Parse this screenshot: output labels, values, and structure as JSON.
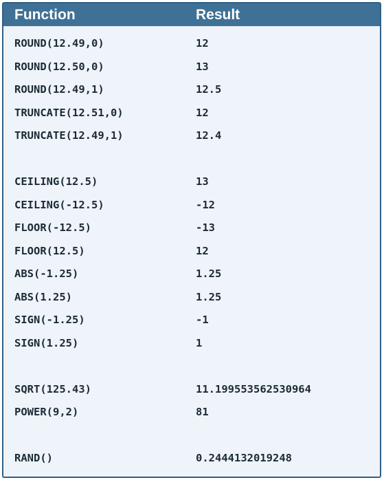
{
  "header": {
    "function_label": "Function",
    "result_label": "Result"
  },
  "rows": [
    {
      "fn": "ROUND(12.49,0)",
      "res": "12"
    },
    {
      "fn": "ROUND(12.50,0)",
      "res": "13"
    },
    {
      "fn": "ROUND(12.49,1)",
      "res": "12.5"
    },
    {
      "fn": "TRUNCATE(12.51,0)",
      "res": "12"
    },
    {
      "fn": "TRUNCATE(12.49,1)",
      "res": "12.4"
    },
    {
      "fn": "CEILING(12.5)",
      "res": "13"
    },
    {
      "fn": "CEILING(-12.5)",
      "res": "-12"
    },
    {
      "fn": "FLOOR(-12.5)",
      "res": "-13"
    },
    {
      "fn": "FLOOR(12.5)",
      "res": "12"
    },
    {
      "fn": "ABS(-1.25)",
      "res": "1.25"
    },
    {
      "fn": "ABS(1.25)",
      "res": "1.25"
    },
    {
      "fn": "SIGN(-1.25)",
      "res": "-1"
    },
    {
      "fn": "SIGN(1.25)",
      "res": "1"
    },
    {
      "fn": "SQRT(125.43)",
      "res": "11.199553562530964"
    },
    {
      "fn": "POWER(9,2)",
      "res": "81"
    },
    {
      "fn": "RAND()",
      "res": "0.2444132019248"
    }
  ],
  "colors": {
    "header_bg": "#3f7096",
    "header_text": "#ffffff",
    "body_bg": "#eef4f9",
    "border": "#2f5f86",
    "text": "#1c2a36"
  }
}
